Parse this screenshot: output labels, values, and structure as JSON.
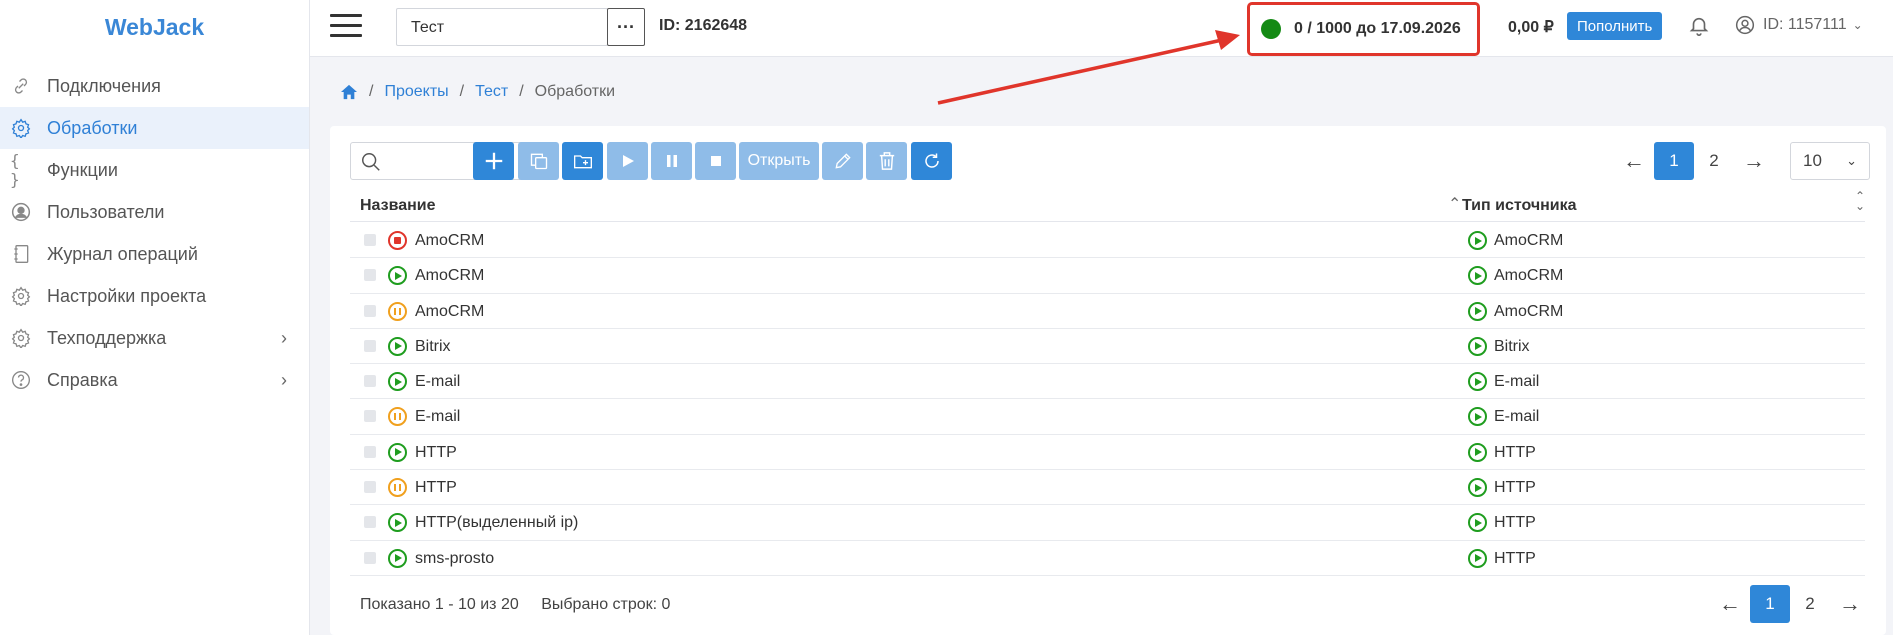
{
  "app": {
    "logo": "WebJack"
  },
  "sidebar": {
    "items": [
      {
        "label": "Подключения",
        "icon": "link-icon",
        "active": false,
        "chevron": false
      },
      {
        "label": "Обработки",
        "icon": "gear-icon",
        "active": true,
        "chevron": false
      },
      {
        "label": "Функции",
        "icon": "braces-icon",
        "active": false,
        "chevron": false
      },
      {
        "label": "Пользователи",
        "icon": "user-icon",
        "active": false,
        "chevron": false
      },
      {
        "label": "Журнал операций",
        "icon": "journal-icon",
        "active": false,
        "chevron": false
      },
      {
        "label": "Настройки проекта",
        "icon": "gear-icon",
        "active": false,
        "chevron": false
      },
      {
        "label": "Техподдержка",
        "icon": "gear-icon",
        "active": false,
        "chevron": true
      },
      {
        "label": "Справка",
        "icon": "question-icon",
        "active": false,
        "chevron": true
      }
    ]
  },
  "header": {
    "project_name": "Тест",
    "project_more": "···",
    "project_id": "ID: 2162648",
    "limit_text": "0 / 1000 до 17.09.2026",
    "limit_status_color": "#148a14",
    "balance": "0,00 ₽",
    "topup_label": "Пополнить",
    "user_id": "ID: 1157111"
  },
  "breadcrumb": {
    "home_icon": "home-icon",
    "items": [
      "Проекты",
      "Тест"
    ],
    "current": "Обработки"
  },
  "toolbar": {
    "search_placeholder": "",
    "open_label": "Открыть"
  },
  "pagination": {
    "prev": "←",
    "next": "→",
    "pages": [
      "1",
      "2"
    ],
    "current": "1",
    "per_page": "10"
  },
  "table": {
    "columns": [
      "Название",
      "Тип источника"
    ],
    "rows": [
      {
        "name": "AmoCRM",
        "status": "stop",
        "source": "AmoCRM"
      },
      {
        "name": "AmoCRM",
        "status": "run",
        "source": "AmoCRM"
      },
      {
        "name": "AmoCRM",
        "status": "pause",
        "source": "AmoCRM"
      },
      {
        "name": "Bitrix",
        "status": "run",
        "source": "Bitrix"
      },
      {
        "name": "E-mail",
        "status": "run",
        "source": "E-mail"
      },
      {
        "name": "E-mail",
        "status": "pause",
        "source": "E-mail"
      },
      {
        "name": "HTTP",
        "status": "run",
        "source": "HTTP"
      },
      {
        "name": "HTTP",
        "status": "pause",
        "source": "HTTP"
      },
      {
        "name": "HTTP(выделенный ip)",
        "status": "run",
        "source": "HTTP"
      },
      {
        "name": "sms-prosto",
        "status": "run",
        "source": "HTTP"
      }
    ]
  },
  "footer": {
    "shown": "Показано 1 - 10 из 20",
    "selected": "Выбрано строк: 0"
  },
  "colors": {
    "accent": "#2f87d8",
    "highlight_border": "#e0352b",
    "status_run": "#1f9d1f",
    "status_pause": "#f0a01e",
    "status_stop": "#e0352b"
  }
}
